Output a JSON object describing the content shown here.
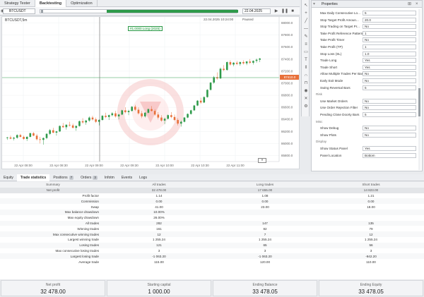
{
  "tabs": [
    "Strategy Tester",
    "Backtesting",
    "Optimization"
  ],
  "active_tab": 1,
  "toolbar": {
    "symbol": "BTCUSDT",
    "end_date": "22.04.2025",
    "status_left": "22.04.2025 10:24:00",
    "status_right": "Paused"
  },
  "chart": {
    "symbol_label": "BTCUSDT,5m",
    "marker_label": "#1.0000 Long (2025)",
    "current_price": "87410.0",
    "price_labels": [
      "88000.0",
      "87800.0",
      "87600.0",
      "87400.0",
      "87200.0",
      "87000.0",
      "86800.0",
      "86600.0",
      "86400.0",
      "86200.0",
      "86000.0",
      "85800.0"
    ],
    "time_labels": [
      "22 Apr 08:00",
      "22 Apr 08:30",
      "22 Apr 09:00",
      "22 Apr 09:30",
      "22 Apr 10:00",
      "22 Apr 10:30",
      "22 Apr 11:00"
    ],
    "colors": {
      "up": "#2e9a4a",
      "down": "#e8703a",
      "accent": "#2e9a4a"
    },
    "candles": [
      [
        86090,
        86110,
        86060,
        86100
      ],
      [
        86100,
        86130,
        86070,
        86080
      ],
      [
        86080,
        86110,
        86050,
        86095
      ],
      [
        86095,
        86150,
        86080,
        86140
      ],
      [
        86140,
        86160,
        86100,
        86110
      ],
      [
        86110,
        86130,
        86060,
        86075
      ],
      [
        86075,
        86120,
        86040,
        86110
      ],
      [
        86110,
        86180,
        86100,
        86170
      ],
      [
        86170,
        86190,
        86120,
        86130
      ],
      [
        86130,
        86160,
        86050,
        86070
      ],
      [
        86070,
        86110,
        86000,
        86060
      ],
      [
        86060,
        86100,
        85980,
        86090
      ],
      [
        86090,
        86170,
        86070,
        86160
      ],
      [
        86160,
        86240,
        86140,
        86220
      ],
      [
        86220,
        86260,
        86170,
        86180
      ],
      [
        86180,
        86210,
        86130,
        86200
      ],
      [
        86200,
        86300,
        86190,
        86290
      ],
      [
        86290,
        86340,
        86260,
        86270
      ],
      [
        86270,
        86320,
        86230,
        86310
      ],
      [
        86310,
        86360,
        86280,
        86300
      ],
      [
        86300,
        86330,
        86250,
        86260
      ],
      [
        86260,
        86300,
        86210,
        86290
      ],
      [
        86290,
        86380,
        86280,
        86370
      ],
      [
        86370,
        86420,
        86330,
        86350
      ],
      [
        86350,
        86390,
        86310,
        86380
      ],
      [
        86380,
        86450,
        86360,
        86430
      ],
      [
        86430,
        86460,
        86380,
        86400
      ],
      [
        86400,
        86430,
        86340,
        86360
      ],
      [
        86360,
        86400,
        86300,
        86390
      ],
      [
        86390,
        86470,
        86380,
        86460
      ],
      [
        86460,
        86510,
        86420,
        86440
      ],
      [
        86440,
        86480,
        86390,
        86470
      ],
      [
        86470,
        86520,
        86450,
        86500
      ],
      [
        86500,
        86540,
        86430,
        86450
      ],
      [
        86450,
        86490,
        86400,
        86480
      ],
      [
        86480,
        86560,
        86470,
        86550
      ],
      [
        86550,
        86600,
        86500,
        86520
      ],
      [
        86520,
        86560,
        86470,
        86540
      ],
      [
        86540,
        86620,
        86530,
        86610
      ],
      [
        86610,
        86640,
        86540,
        86560
      ],
      [
        86560,
        86600,
        86480,
        86500
      ],
      [
        86500,
        86540,
        86420,
        86450
      ],
      [
        86450,
        86520,
        86430,
        86510
      ],
      [
        86510,
        86580,
        86500,
        86570
      ],
      [
        86570,
        86620,
        86530,
        86540
      ],
      [
        86540,
        86570,
        86460,
        86480
      ],
      [
        86480,
        86520,
        86400,
        86430
      ],
      [
        86430,
        86470,
        86360,
        86380
      ],
      [
        86380,
        86430,
        86320,
        86410
      ],
      [
        86410,
        86480,
        86400,
        86470
      ],
      [
        86470,
        86520,
        86420,
        86440
      ],
      [
        86440,
        86480,
        86370,
        86390
      ],
      [
        86390,
        86420,
        86300,
        86330
      ],
      [
        86330,
        86380,
        86280,
        86360
      ],
      [
        86360,
        86440,
        86350,
        86430
      ],
      [
        86430,
        86500,
        86420,
        86490
      ],
      [
        86490,
        86560,
        86480,
        86550
      ],
      [
        86550,
        86640,
        86540,
        86630
      ],
      [
        86630,
        86720,
        86620,
        86710
      ],
      [
        86710,
        86760,
        86660,
        86680
      ],
      [
        86680,
        86780,
        86670,
        86770
      ],
      [
        86770,
        86900,
        86760,
        86890
      ],
      [
        86890,
        87020,
        86880,
        87010
      ],
      [
        87010,
        87120,
        86990,
        87100
      ],
      [
        87100,
        87180,
        87060,
        87080
      ],
      [
        87080,
        87260,
        87070,
        87240
      ],
      [
        87240,
        87300,
        87200,
        87220
      ],
      [
        87220,
        87360,
        87210,
        87350
      ],
      [
        87350,
        87380,
        87290,
        87310
      ],
      [
        87310,
        87350,
        87280,
        87340
      ],
      [
        87340,
        87370,
        87300,
        87320
      ],
      [
        87320,
        87360,
        87290,
        87350
      ],
      [
        87350,
        87380,
        87310,
        87330
      ],
      [
        87330,
        87370,
        87300,
        87360
      ],
      [
        87360,
        87400,
        87320,
        87340
      ],
      [
        87340,
        87380,
        87310,
        87370
      ],
      [
        87370,
        87410,
        87340,
        87390
      ],
      [
        87390,
        87420,
        87350,
        87410
      ]
    ]
  },
  "props": {
    "title": "Properties",
    "rows": [
      {
        "label": "Max Daily Consecutive Lo...",
        "value": "5"
      },
      {
        "label": "Stop Target Profit Amoun...",
        "value": "20.0"
      },
      {
        "label": "Stop Trading on Target Pr...",
        "value": "No"
      },
      {
        "label": "Take Profit Reference Pattern",
        "value": "1"
      },
      {
        "label": "Take Profit Timer",
        "value": "No"
      },
      {
        "label": "Take Profit (TP)",
        "value": "1"
      },
      {
        "label": "Stop Loss (SL)",
        "value": "1.0"
      },
      {
        "label": "Trade Long",
        "value": "Yes"
      },
      {
        "label": "Trade Short",
        "value": "Yes"
      },
      {
        "label": "Allow Multiple Trades Per Bar",
        "value": "No"
      },
      {
        "label": "Early Exit Mode",
        "value": "No"
      },
      {
        "label": "Swing Reversal Bars",
        "value": "5"
      }
    ],
    "section2": "Risk",
    "rows2": [
      {
        "label": "Use Market Orders",
        "value": "No"
      },
      {
        "label": "Use Order Rejection Filter",
        "value": "No"
      },
      {
        "label": "Pending Close Doorty Bars",
        "value": "5"
      }
    ],
    "section3": "Misc",
    "rows3": [
      {
        "label": "Show Debug",
        "value": "No"
      },
      {
        "label": "Show Plots",
        "value": "No"
      }
    ],
    "section4": "Display",
    "rows4": [
      {
        "label": "Show Status Panel",
        "value": "Yes"
      },
      {
        "label": "Panel Location",
        "value": "Bottom"
      }
    ]
  },
  "bottom_tabs": [
    {
      "label": "Equity"
    },
    {
      "label": "Trade statistics"
    },
    {
      "label": "Positions",
      "badge": "7"
    },
    {
      "label": "Orders",
      "badge": "3"
    },
    {
      "label": "Infotm"
    },
    {
      "label": "Events"
    },
    {
      "label": "Logs"
    }
  ],
  "bottom_active": 1,
  "table": {
    "headers": [
      "Summary",
      "All trades",
      "Long trades",
      "Short trades"
    ],
    "subheaders": [
      "Net profit",
      "32 478.00",
      "17 655.00",
      "14 823.00"
    ],
    "rows": [
      [
        "Profit factor",
        "1.14",
        "1.08",
        "1.21"
      ],
      [
        "Commission",
        "0.00",
        "0.00",
        "0.00"
      ],
      [
        "Swap",
        "41.00",
        "23.00",
        "18.00"
      ],
      [
        "Max balance drawdown",
        "10.00%",
        "",
        ""
      ],
      [
        "Max equity drawdown",
        "26.00%",
        "",
        ""
      ],
      [
        "All trades",
        "282",
        "147",
        "135"
      ],
      [
        "Winning trades",
        "161",
        "82",
        "79"
      ],
      [
        "Max consecutive winning trades",
        "12",
        "7",
        "12"
      ],
      [
        "Largest winning trade",
        "1 255.24",
        "1 255.24",
        "1 255.24"
      ],
      [
        "Losing trades",
        "121",
        "65",
        "56"
      ],
      [
        "Max consecutive losing trades",
        "3",
        "3",
        "3"
      ],
      [
        "Largest losing trade",
        "-1 063.20",
        "-1 063.20",
        "-942.20"
      ],
      [
        "Average trade",
        "115.00",
        "120.00",
        "110.00"
      ]
    ]
  },
  "summary": [
    {
      "title": "Net profit",
      "value": "32 478.00"
    },
    {
      "title": "Starting capital",
      "value": "1 000.00"
    },
    {
      "title": "Ending Balance",
      "value": "33 478.05"
    },
    {
      "title": "Ending Equity",
      "value": "33 478.05"
    }
  ]
}
